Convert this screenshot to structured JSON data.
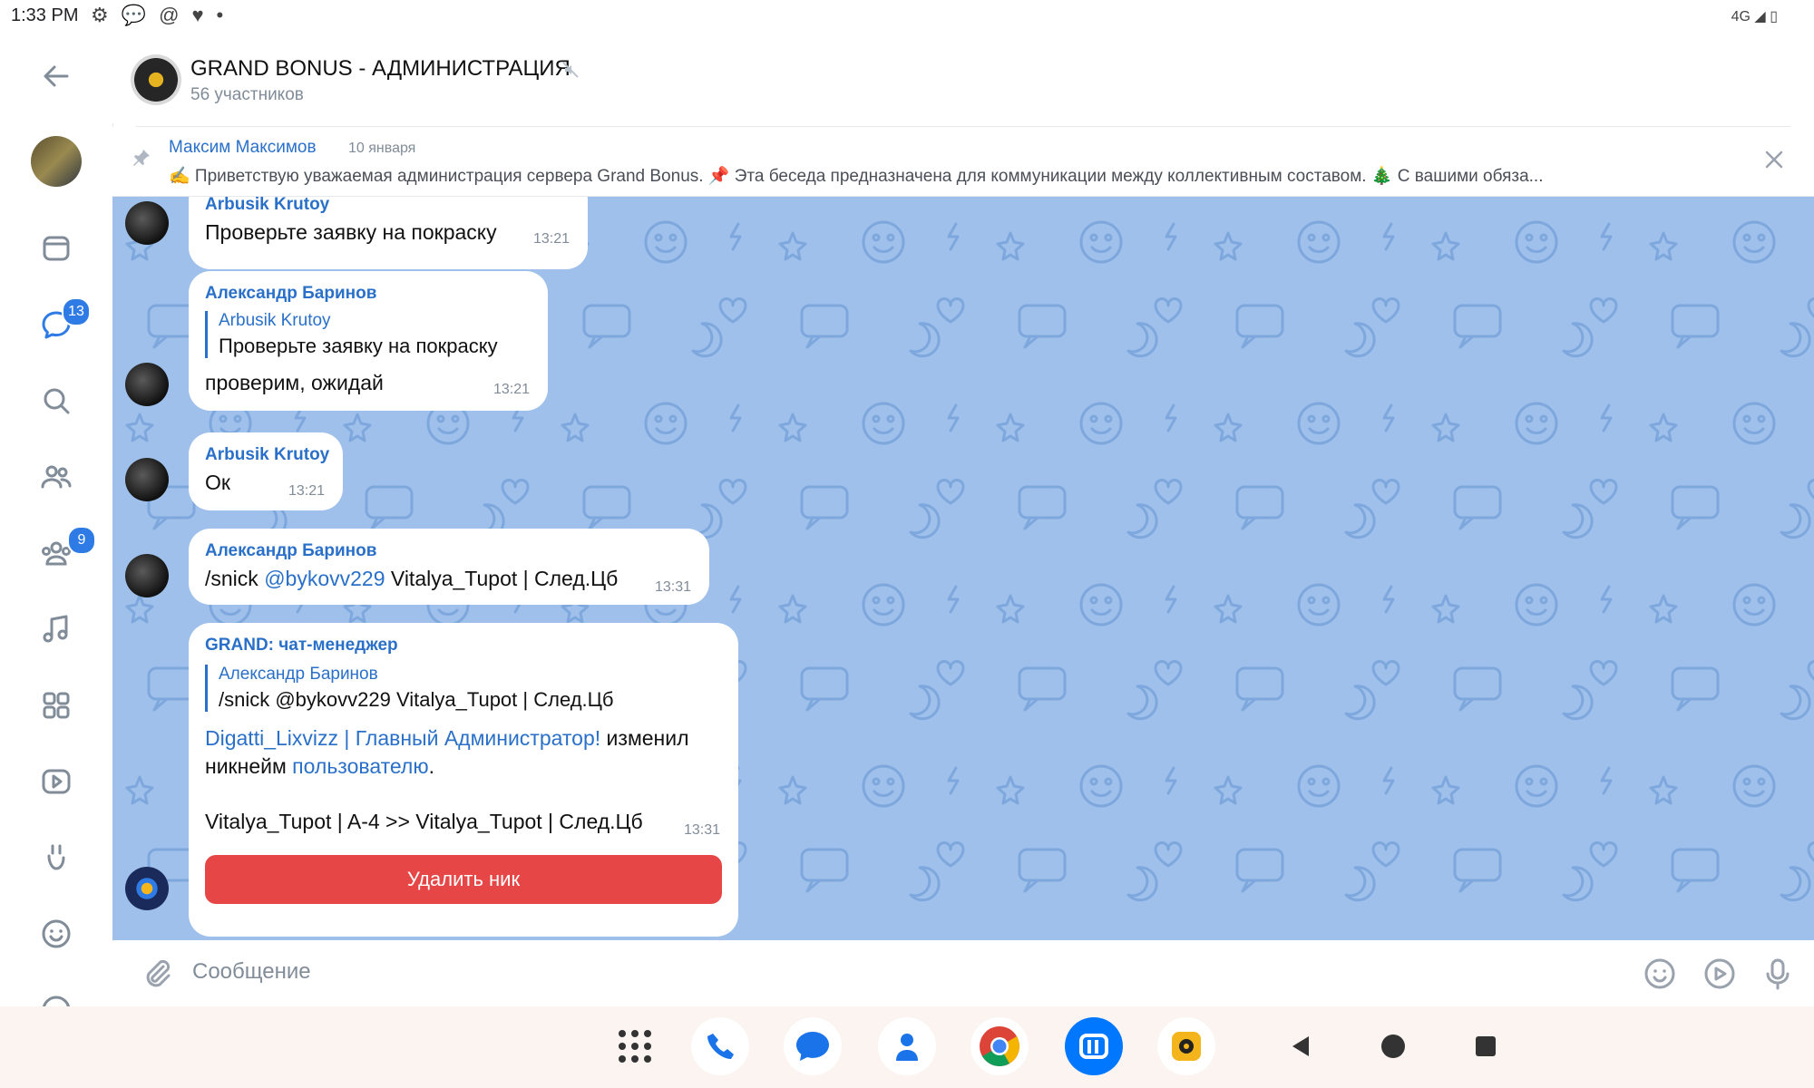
{
  "status_bar": {
    "time": "1:33 PM",
    "network": "4G"
  },
  "rail": {
    "chats_badge": "13",
    "communities_badge": "9"
  },
  "header": {
    "title": "GRAND BONUS - АДМИНИСТРАЦИЯ",
    "subtitle": "56 участников"
  },
  "pinned": {
    "author": "Максим Максимов",
    "date": "10 января",
    "text": "✍️ Приветствую  уважаемая администрация сервера Grand Bonus. 📌 Эта беседа предназначена для коммуникации между коллективным составом. 🎄 С вашими обяза..."
  },
  "messages": [
    {
      "author": "Arbusik Krutoy",
      "text": "Проверьте заявку на покраску",
      "time": "13:21"
    },
    {
      "author": "Александр Баринов",
      "reply_author": "Arbusik Krutoy",
      "reply_text": "Проверьте заявку на покраску",
      "text": "проверим, ожидай",
      "time": "13:21"
    },
    {
      "author": "Arbusik Krutoy",
      "text": "Ок",
      "time": "13:21"
    },
    {
      "author": "Александр Баринов",
      "text_pre": "/snick ",
      "mention": "@bykovv229",
      "text_post": " Vitalya_Tupot | След.Цб",
      "time": "13:31"
    },
    {
      "author": "GRAND: чат-менеджер",
      "reply_author": "Александр Баринов",
      "reply_text": "/snick @bykovv229 Vitalya_Tupot | След.Цб",
      "admin_link": "Digatti_Lixvizz | Главный Администратор!",
      "line1_post": " изменил",
      "line2_pre": "никнейм ",
      "user_link": "пользователю",
      "line2_post": ".",
      "change_text": "Vitalya_Tupot | A-4 >> Vitalya_Tupot | След.Цб",
      "time": "13:31",
      "button": "Удалить ник"
    }
  ],
  "composer": {
    "placeholder": "Сообщение"
  },
  "icons": {
    "back": "back-arrow-icon",
    "pin": "pin-icon",
    "close": "close-icon",
    "mute": "mute-icon",
    "clip": "paperclip-icon",
    "emoji": "emoji-icon",
    "mic": "microphone-icon"
  },
  "colors": {
    "accent": "#2a70c9",
    "chat_bg": "#9ec0ea",
    "badge": "#2f7be5",
    "delete_button": "#e64646"
  }
}
